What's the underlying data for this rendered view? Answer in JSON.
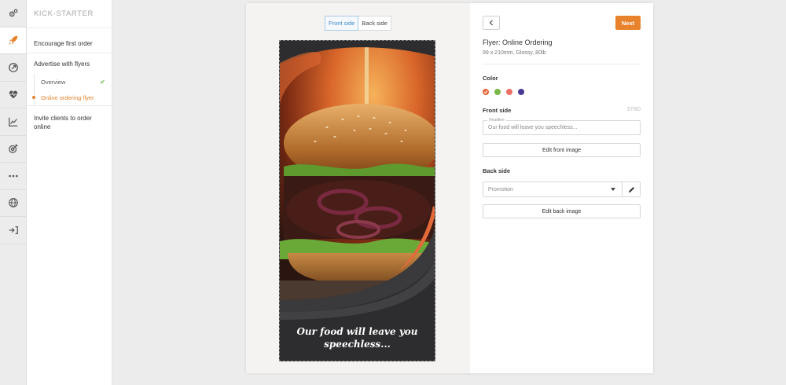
{
  "sidebar": {
    "brand": "KICK-STARTER",
    "items": [
      {
        "label": "Encourage first order"
      },
      {
        "label": "Advertise with flyers"
      },
      {
        "label": "Invite clients to order online"
      }
    ],
    "subitems": [
      {
        "label": "Overview",
        "status": "done"
      },
      {
        "label": "Online ordering flyer",
        "status": "current"
      }
    ]
  },
  "rail_icons": [
    "gears-icon",
    "rocket-icon",
    "compass-icon",
    "heartbeat-icon",
    "chart-icon",
    "target-icon",
    "more-icon",
    "globe-icon",
    "signin-icon"
  ],
  "preview": {
    "tabs": [
      {
        "label": "Front side",
        "active": true
      },
      {
        "label": "Back side",
        "active": false
      }
    ],
    "flyer_text": "Our food will leave you speechless..."
  },
  "panel": {
    "next_label": "Next",
    "title": "Flyer: Online Ordering",
    "subtitle": "99 x 210mm, Glossy, 80lb",
    "color_label": "Color",
    "colors": [
      "#e8623a",
      "#7ab648",
      "#ec7066",
      "#4a3a96"
    ],
    "front_label": "Front side",
    "front_counter": "37/60",
    "headline_legend": "Headline",
    "headline_value": "Our food will leave you speechless...",
    "edit_front_label": "Edit front image",
    "back_label": "Back side",
    "back_select_value": "Promotion",
    "edit_back_label": "Edit back image"
  },
  "colors": {
    "accent": "#e8822c",
    "link_blue": "#3d87c6",
    "check_green": "#6cbe45"
  }
}
